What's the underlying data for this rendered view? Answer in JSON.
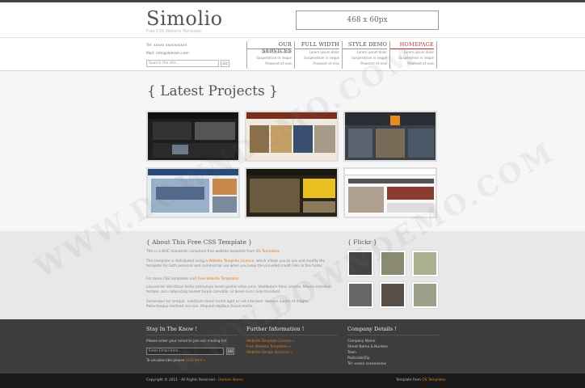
{
  "header": {
    "logo": "Simolio",
    "tagline": "Free CSS Website Template",
    "banner_label": "468 x 60px"
  },
  "contact": {
    "tel": "Tel: xxxxx xxxxxxxxxx",
    "mail": "Mail: info@domain.com"
  },
  "search": {
    "placeholder": "Search the site...",
    "button_label": "GO"
  },
  "nav": [
    {
      "title": "OUR SERVICES",
      "sub": [
        "Lorem ipsum dolor",
        "Suspendisse in neque",
        "Praesent et eros"
      ]
    },
    {
      "title": "FULL WIDTH",
      "sub": [
        "Lorem ipsum dolor",
        "Suspendisse in neque",
        "Praesent et eros"
      ]
    },
    {
      "title": "STYLE DEMO",
      "sub": [
        "Lorem ipsum dolor",
        "Suspendisse in neque",
        "Praesent et eros"
      ]
    },
    {
      "title": "HOMEPAGE",
      "sub": [
        "Lorem ipsum dolor",
        "Suspendisse in neque",
        "Praesent et eros"
      ]
    }
  ],
  "projects": {
    "title": "{ Latest Projects }"
  },
  "about": {
    "title": "{ About This Free CSS Template }",
    "p1": "This is a W3C standards compliant free website template from ",
    "p1_link": "OS Templates",
    "p2": "This template is distributed using a ",
    "p2_link": "Website Template Licence",
    "p2_rest": ", which allows you to use and modify the template for both personal and commercial use when you keep the provided credit links in the footer.",
    "p3": "For more CSS templates visit ",
    "p3_link": "Free Website Templates",
    "p4": "Lacusenim inte ittoos tortor pretiumpo lorem gestas vitae urna. Vestibulum fetus viverra. Mauris interdum tempor, arcu adipiscing laoreet turpis convallis, ut lorem nunc ante tincidunt.",
    "p5": "Semenque tor sempor, nabilitum lorem lorem aget ac vel interdum. Aenean auctor et magna. Pellentesque eleifend nisi non. Aliquam dapibus fiusce mollis."
  },
  "flickr": {
    "title": "{ Flickr }"
  },
  "footer": {
    "col1_title": "Stay In The Know !",
    "col1_text": "Please enter your email to join our mailing list",
    "email_placeholder": "Enter Email Here...",
    "email_button": "GO",
    "unsubscribe": "To unsubscribe please ",
    "unsubscribe_link": "click here »",
    "col2_title": "Further Information !",
    "col2_links": [
      "Website Template Licence »",
      "Free Website Templates »",
      "Website Design Services »"
    ],
    "col3_title": "Company Details !",
    "company": [
      "Company Name",
      "Street Name & Number",
      "Town",
      "Postcode/Zip",
      "Tel: xxxxx xxxxxxxxxx"
    ]
  },
  "bottom": {
    "copyright": "Copyright © 2011 - All Rights Reserved - ",
    "copyright_link": "Domain Name",
    "credit": "Template from ",
    "credit_link": "OS Templates"
  },
  "watermark": "WWW.DOWNDEMO.COM",
  "colors": {
    "accent": "#e07a1f",
    "nav_active": "#bb3333",
    "footer_bg": "#3d3d3d",
    "bottom_bg": "#1a1a1a"
  }
}
